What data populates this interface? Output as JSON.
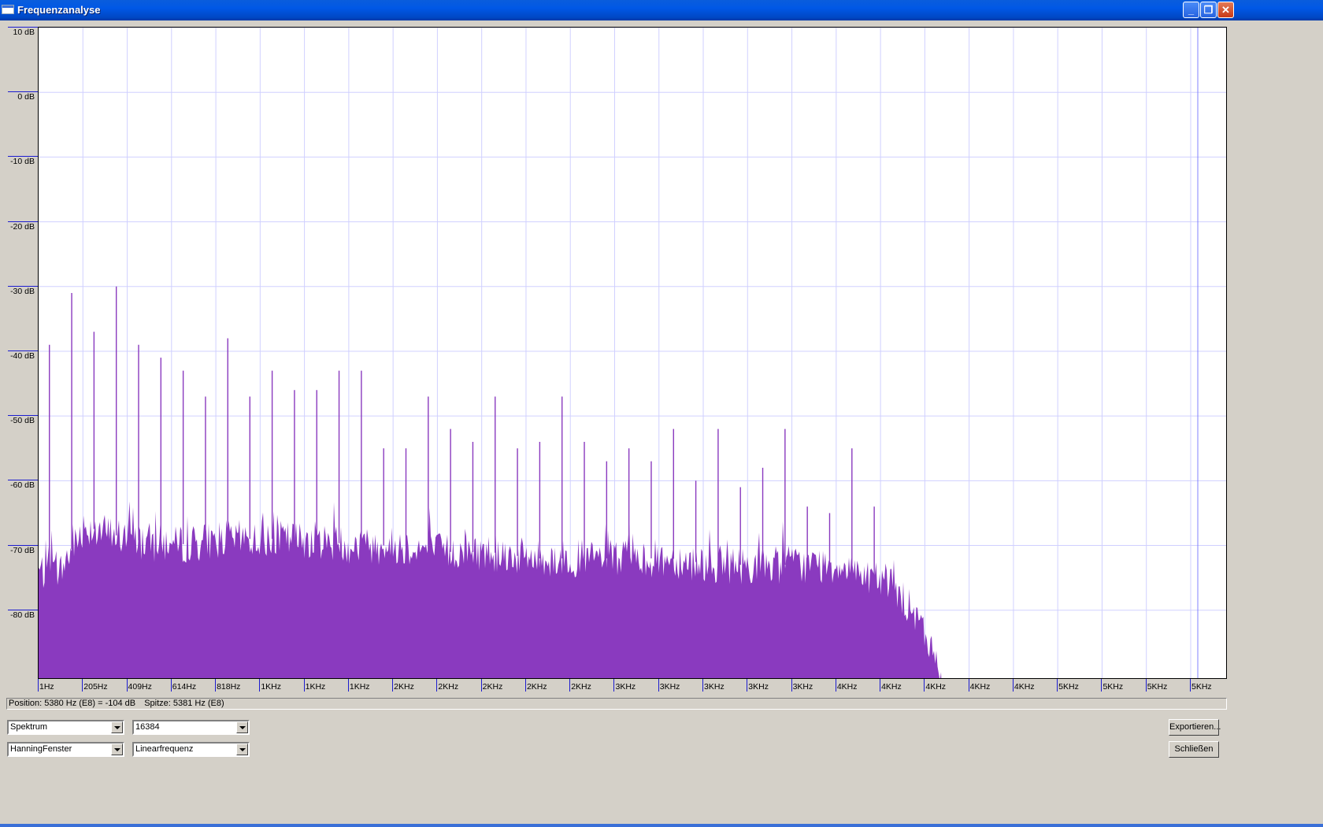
{
  "window": {
    "title": "Frequenzanalyse",
    "controls": [
      "minimize",
      "restore",
      "close"
    ]
  },
  "chart_data": {
    "type": "area",
    "title": "",
    "xlabel": "",
    "ylabel": "",
    "y_ticks": [
      "10 dB",
      "0 dB",
      "-10 dB",
      "-20 dB",
      "-30 dB",
      "-40 dB",
      "-50 dB",
      "-60 dB",
      "-70 dB",
      "-80 dB"
    ],
    "x_ticks": [
      "1Hz",
      "205Hz",
      "409Hz",
      "614Hz",
      "818Hz",
      "1KHz",
      "1KHz",
      "1KHz",
      "2KHz",
      "2KHz",
      "2KHz",
      "2KHz",
      "2KHz",
      "3KHz",
      "3KHz",
      "3KHz",
      "3KHz",
      "3KHz",
      "4KHz",
      "4KHz",
      "4KHz",
      "4KHz",
      "4KHz",
      "5KHz",
      "5KHz",
      "5KHz",
      "5KHz"
    ],
    "ylim": [
      -90.5,
      10
    ],
    "xlim": [
      1,
      5380
    ],
    "grid": true,
    "color": "#8a3abf",
    "cursor_hz": 5380,
    "baseline": {
      "x": [
        1,
        100,
        205,
        409,
        614,
        818,
        1024,
        1228,
        1432,
        1636,
        1841,
        2045,
        2250,
        2454,
        2659,
        2864,
        3068,
        3273,
        3477,
        3682,
        3784,
        3886,
        3950,
        4020,
        4090
      ],
      "y": [
        -74,
        -74,
        -67,
        -69,
        -70,
        -69,
        -69,
        -69,
        -70,
        -70,
        -71,
        -71,
        -72,
        -72,
        -72,
        -72,
        -73,
        -73,
        -73,
        -73,
        -75,
        -77,
        -80,
        -84,
        -90.5
      ]
    },
    "peaks": {
      "x": [
        50,
        151,
        252,
        353,
        454,
        555,
        656,
        757,
        858,
        958,
        1059,
        1160,
        1261,
        1362,
        1463,
        1564,
        1665,
        1766,
        1867,
        1968,
        2069,
        2170,
        2271,
        2372,
        2473,
        2574,
        2675,
        2776,
        2877,
        2978,
        3079,
        3180,
        3281,
        3382,
        3483,
        3584,
        3685,
        3786
      ],
      "y": [
        -39,
        -31,
        -37,
        -30,
        -39,
        -41,
        -43,
        -47,
        -38,
        -47,
        -43,
        -46,
        -46,
        -43,
        -43,
        -55,
        -55,
        -47,
        -52,
        -54,
        -47,
        -55,
        -54,
        -47,
        -54,
        -57,
        -55,
        -57,
        -52,
        -60,
        -52,
        -61,
        -58,
        -52,
        -64,
        -65,
        -55,
        -64
      ]
    }
  },
  "status": {
    "position": "Position: 5380 Hz (E8) = -104 dB",
    "peak": "Spitze: 5381 Hz (E8)"
  },
  "controls": {
    "algorithm": "Spektrum",
    "size": "16384",
    "window_func": "HanningFenster",
    "axis": "Linearfrequenz"
  },
  "buttons": {
    "export": "Exportieren...",
    "close": "Schließen"
  }
}
